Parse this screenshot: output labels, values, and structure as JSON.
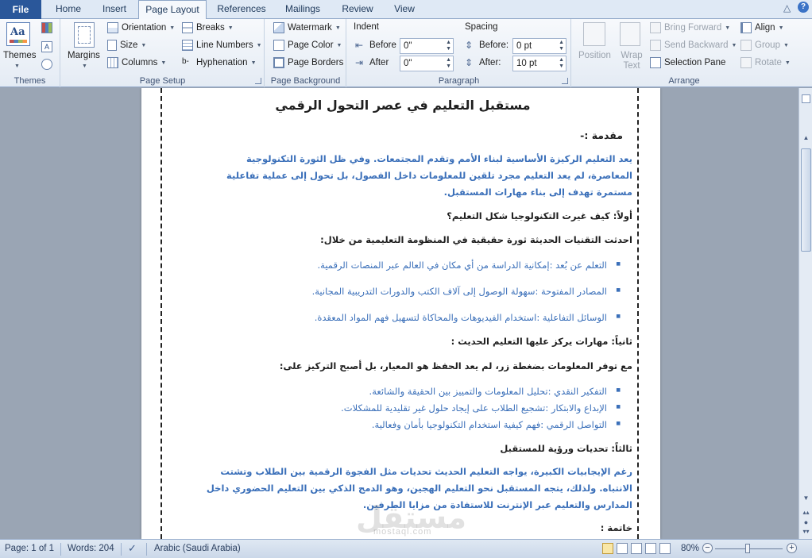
{
  "tabs": [
    "File",
    "Home",
    "Insert",
    "Page Layout",
    "References",
    "Mailings",
    "Review",
    "View"
  ],
  "active_tab": "Page Layout",
  "ribbon": {
    "themes": {
      "button": "Themes",
      "group": "Themes"
    },
    "page_setup": {
      "margins": "Margins",
      "orientation": "Orientation",
      "size": "Size",
      "columns": "Columns",
      "breaks": "Breaks",
      "line_numbers": "Line Numbers",
      "hyphenation": "Hyphenation",
      "group": "Page Setup"
    },
    "page_background": {
      "watermark": "Watermark",
      "page_color": "Page Color",
      "page_borders": "Page Borders",
      "group": "Page Background"
    },
    "paragraph": {
      "indent_header": "Indent",
      "before_label": "Before",
      "before_value": "0\"",
      "after_label": "After",
      "after_value": "0\"",
      "spacing_header": "Spacing",
      "sp_before_label": "Before:",
      "sp_before_value": "0 pt",
      "sp_after_label": "After:",
      "sp_after_value": "10 pt",
      "group": "Paragraph"
    },
    "arrange": {
      "position": "Position",
      "wrap_text": "Wrap Text",
      "bring_forward": "Bring Forward",
      "send_backward": "Send Backward",
      "selection_pane": "Selection Pane",
      "align": "Align",
      "group_btn": "Group",
      "rotate": "Rotate",
      "group": "Arrange"
    }
  },
  "document": {
    "title": "مستقبل التعليم في عصر التحول الرقمي",
    "intro_heading": "مقدمة :-",
    "intro_lines": [
      "يعد التعليم الركيزة الأساسية لبناء الأمم وتقدم المجتمعات. وفي ظل الثورة التكنولوجية",
      "المعاصرة، لم يعد التعليم مجرد تلقين للمعلومات داخل الفصول، بل تحول إلى عملية تفاعلية",
      "مستمرة تهدف إلى بناء مهارات المستقبل."
    ],
    "section1_heading": "أولاً: كيف غيرت التكنولوجيا شكل التعليم؟",
    "section1_sub": "احدثت التقنيات الحديثة ثورة حقيقية في المنظومة التعليمية من خلال:",
    "section1_items": [
      "التعلم عن بُعد :إمكانية الدراسة من أي مكان في العالم عبر المنصات الرقمية.",
      "المصادر المفتوحة :سهولة الوصول إلى آلاف الكتب والدورات التدريبية المجانية.",
      "الوسائل التفاعلية :استخدام الفيديوهات والمحاكاة لتسهيل فهم المواد المعقدة."
    ],
    "section2_heading": "ثانياً: مهارات يركز عليها التعليم الحديث :",
    "section2_sub": "مع توفر المعلومات بضغطة زر، لم يعد الحفظ هو المعيار، بل أصبح التركيز على:",
    "section2_items": [
      "التفكير النقدي :تحليل المعلومات والتمييز بين الحقيقة والشائعة.",
      "الإبداع والابتكار :تشجيع الطلاب على إيجاد حلول غير تقليدية للمشكلات.",
      "التواصل الرقمي :فهم كيفية استخدام التكنولوجيا بأمان وفعالية."
    ],
    "section3_heading": "ثالثاً: تحديات ورؤية للمستقبل",
    "section3_lines": [
      "رغم الإيجابيات الكبيرة، يواجه التعليم الحديث تحديات مثل الفجوة الرقمية بين الطلاب وتشتت",
      "الانتباه. ولذلك، يتجه المستقبل نحو التعليم الهجين، وهو الدمج الذكي بين التعليم الحضوري داخل",
      "المدارس والتعليم عبر الإنترنت للاستفادة من مزايا الطرفين."
    ],
    "conclusion_heading": "خاتمة :"
  },
  "watermark": {
    "ar": "مستقل",
    "en": "mostaql.com"
  },
  "status": {
    "page": "Page: 1 of 1",
    "words": "Words: 204",
    "language": "Arabic (Saudi Arabia)",
    "zoom": "80%",
    "zoom_level": 0.8
  },
  "colors": {
    "accent": "#2a579a",
    "doc_blue": "#3a6fb9"
  }
}
